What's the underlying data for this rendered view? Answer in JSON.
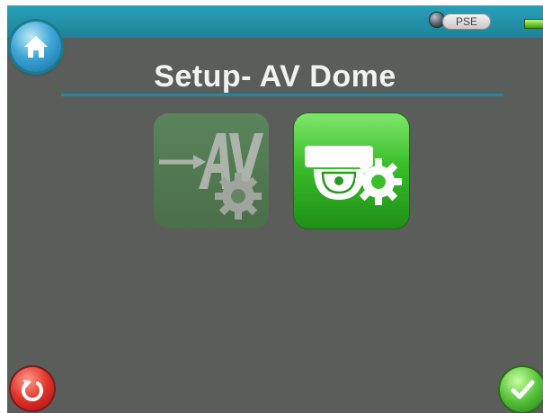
{
  "header": {
    "title": "Setup- AV Dome",
    "pse_label": "PSE"
  },
  "icons": {
    "home": "home-icon",
    "pse_indicator": "status-led-icon",
    "battery": "battery-icon",
    "av_settings": "av-gear-icon",
    "dome_settings": "dome-camera-gear-icon",
    "reset": "power-reset-icon",
    "confirm": "checkmark-icon"
  },
  "colors": {
    "topbar": "#1c8398",
    "background": "#5b5d5a",
    "accent_green": "#3bbd2c",
    "reset_red": "#e0322a"
  }
}
